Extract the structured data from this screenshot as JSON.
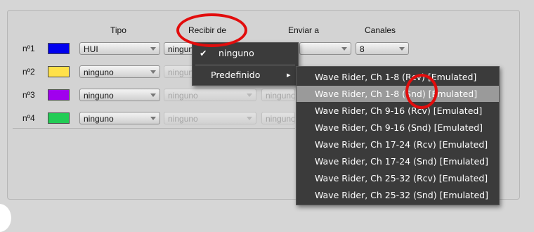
{
  "headers": {
    "tipo": "Tipo",
    "recibir_de": "Recibir de",
    "enviar_a": "Enviar a",
    "canales": "Canales"
  },
  "rows": [
    {
      "label": "nº1",
      "color": "#0000ee",
      "tipo": "HUI",
      "recibir": "ninguno",
      "enviar": "",
      "canales": "8"
    },
    {
      "label": "nº2",
      "color": "#ffe14a",
      "tipo": "ninguno",
      "recibir": "ninguno",
      "enviar": "",
      "canales": ""
    },
    {
      "label": "nº3",
      "color": "#a000ee",
      "tipo": "ninguno",
      "recibir": "ninguno",
      "enviar": "ninguno",
      "canales": ""
    },
    {
      "label": "nº4",
      "color": "#22cc55",
      "tipo": "ninguno",
      "recibir": "ninguno",
      "enviar": "ninguno",
      "canales": ""
    }
  ],
  "menu": {
    "checkmark": "✔",
    "ninguno": "ninguno",
    "predefinido": "Predefinido",
    "submenu_arrow": "▸"
  },
  "submenu": [
    "Wave Rider, Ch 1-8 (Rcv) [Emulated]",
    "Wave Rider, Ch 1-8 (Snd) [Emulated]",
    "Wave Rider, Ch 9-16 (Rcv) [Emulated]",
    "Wave Rider, Ch 9-16 (Snd) [Emulated]",
    "Wave Rider, Ch 17-24 (Rcv) [Emulated]",
    "Wave Rider, Ch 17-24 (Snd) [Emulated]",
    "Wave Rider, Ch 25-32 (Rcv) [Emulated]",
    "Wave Rider, Ch 25-32 (Snd) [Emulated]"
  ],
  "colors": {
    "highlight": "#9a9a9a",
    "menu_bg": "#3b3b3b",
    "annotation": "#e20d0d"
  }
}
